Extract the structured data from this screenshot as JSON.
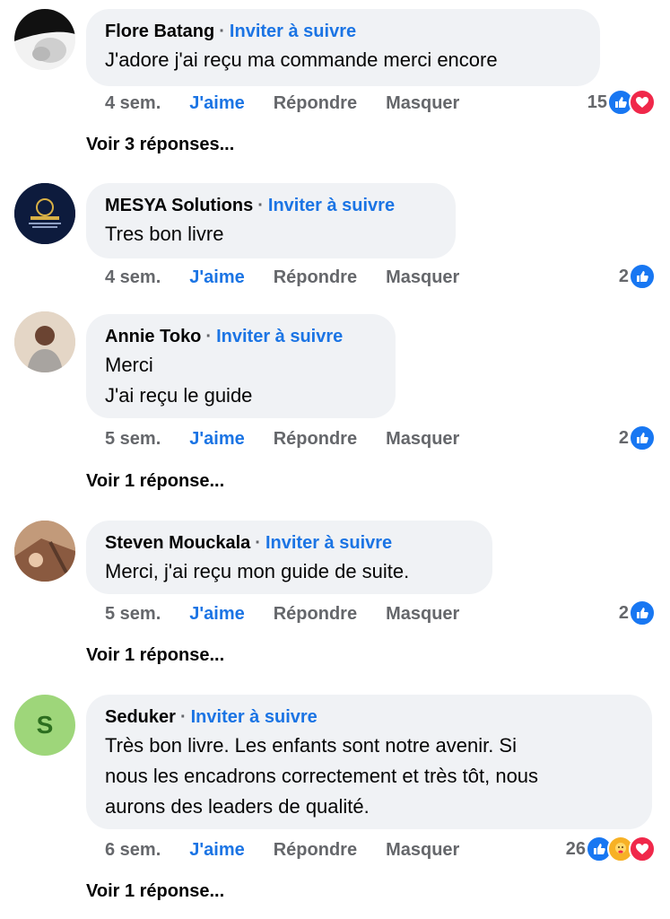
{
  "comments": [
    {
      "author": "Flore Batang",
      "follow": "Inviter à suivre",
      "text": "J'adore j'ai reçu ma commande merci encore",
      "time": "4 sem.",
      "like": "J'aime",
      "reply": "Répondre",
      "hide": "Masquer",
      "reaction_count": "15",
      "reactions": [
        "like-icon",
        "love-icon"
      ],
      "replies": "Voir 3 réponses..."
    },
    {
      "author": "MESYA Solutions",
      "follow": "Inviter à suivre",
      "text": "Tres bon livre",
      "time": "4 sem.",
      "like": "J'aime",
      "reply": "Répondre",
      "hide": "Masquer",
      "reaction_count": "2",
      "reactions": [
        "like-icon"
      ],
      "replies": ""
    },
    {
      "author": "Annie Toko",
      "follow": "Inviter à suivre",
      "text": "Merci\nJ'ai reçu le guide",
      "time": "5 sem.",
      "like": "J'aime",
      "reply": "Répondre",
      "hide": "Masquer",
      "reaction_count": "2",
      "reactions": [
        "like-icon"
      ],
      "replies": "Voir 1 réponse..."
    },
    {
      "author": "Steven Mouckala",
      "follow": "Inviter à suivre",
      "text": "Merci, j'ai reçu mon guide de suite.",
      "time": "5 sem.",
      "like": "J'aime",
      "reply": "Répondre",
      "hide": "Masquer",
      "reaction_count": "2",
      "reactions": [
        "like-icon"
      ],
      "replies": "Voir 1 réponse..."
    },
    {
      "author": "Seduker",
      "follow": "Inviter à suivre",
      "text": "Très bon livre. Les enfants sont notre avenir. Si\nnous les encadrons correctement et très tôt, nous\naurons des leaders de qualité.",
      "time": "6 sem.",
      "like": "J'aime",
      "reply": "Répondre",
      "hide": "Masquer",
      "reaction_count": "26",
      "reactions": [
        "like-icon",
        "care-icon",
        "love-icon"
      ],
      "replies": "Voir 1 réponse...",
      "avatar_letter": "S"
    }
  ],
  "colors": {
    "link": "#1b74e4",
    "bubble": "#f0f2f5",
    "muted": "#65676b"
  }
}
